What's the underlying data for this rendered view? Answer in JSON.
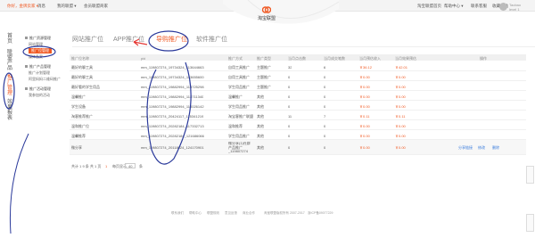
{
  "topbar": {
    "greeting": "你好，金牌卖家 ▾",
    "msg": "消息",
    "myalimama": "我的联盟 ▾",
    "member": "会员联盟商家",
    "tb_home": "淘宝联盟首页",
    "help": "帮助中心 ▾",
    "service": "联系客服",
    "favorite": "收藏本站"
  },
  "brand": {
    "name": "淘宝联盟"
  },
  "user": {
    "line1": "Taobao",
    "line2": "level 1"
  },
  "left_nav": [
    {
      "label": "首页"
    },
    {
      "label": "联盟产品"
    },
    {
      "label": "推广管理"
    },
    {
      "label": "效果报表"
    }
  ],
  "submenu": {
    "sec1": "推广资源管理",
    "item1": "网站管理",
    "item1_active": "推广位管理",
    "item2": "媒体备案",
    "sec2": "推广产品管理",
    "item3": "推广计划管理",
    "item4": "阿里妈妈二维码推广",
    "sec3": "推广活动管理",
    "item5": "我参加的活动"
  },
  "tabs": [
    {
      "label": "网站推广位"
    },
    {
      "label": "APP推广位"
    },
    {
      "label": "导购推广位"
    },
    {
      "label": "软件推广位"
    }
  ],
  "table": {
    "headers": [
      "推广位名称",
      "pid",
      "推广方式",
      "推广类型",
      "当月点击数",
      "当月成交笔数",
      "当月预估收入",
      "当月效果预估",
      "操作"
    ],
    "rows": [
      {
        "name": "最好的聊工具",
        "pid": "mm_119807274_19734324_113644663",
        "way": "自用工具推广",
        "type": "主题推广",
        "clicks": "32",
        "orders": "6",
        "income": "￥36.12",
        "est": "￥42.01"
      },
      {
        "name": "最好的聊工具",
        "pid": "mm_119807274_19734324_113655600",
        "way": "自用工具推广",
        "type": "主题推广",
        "clicks": "0",
        "orders": "0",
        "income": "￥0.00",
        "est": "￥0.00"
      },
      {
        "name": "最好看的学生用品",
        "pid": "mm_119807274_19882994_113725298",
        "way": "学生用品推广",
        "type": "主题推广",
        "clicks": "0",
        "orders": "0",
        "income": "￥0.00",
        "est": "￥0.00"
      },
      {
        "name": "温馨推广",
        "pid": "mm_119807274_19882994_113711340",
        "way": "温馨推广",
        "type": "其他",
        "clicks": "0",
        "orders": "0",
        "income": "￥0.00",
        "est": "￥0.00"
      },
      {
        "name": "学生设备",
        "pid": "mm_119807274_19882994_114026142",
        "way": "学生用品推广",
        "type": "其他",
        "clicks": "0",
        "orders": "0",
        "income": "￥0.00",
        "est": "￥0.00"
      },
      {
        "name": "淘客推荐推广",
        "pid": "mm_119807274_20424117_115341219",
        "way": "淘宝客推广联盟",
        "type": "其他",
        "clicks": "11",
        "orders": "7",
        "income": "￥0.11",
        "est": "￥0.11"
      },
      {
        "name": "温和推广位",
        "pid": "mm_119807274_20282184_117332713",
        "way": "温和推荐",
        "type": "其他",
        "clicks": "0",
        "orders": "0",
        "income": "￥0.00",
        "est": "￥0.00"
      },
      {
        "name": "温馨推荐",
        "pid": "mm_119807274_20282184_121686066",
        "way": "学生用品推广",
        "type": "其他",
        "clicks": "0",
        "orders": "0",
        "income": "￥0.00",
        "est": "￥0.00"
      },
      {
        "name": "微分享",
        "pid": "mm_119807274_20118624_124170901",
        "way": "微分享(1)社群产品推广_119807274",
        "type": "其他",
        "clicks": "0",
        "orders": "0",
        "income": "￥0.00",
        "est": "￥0.00",
        "actions": [
          "分享链接",
          "修改",
          "删除"
        ]
      }
    ]
  },
  "pager": {
    "summary": "共计 1 9 条 共 1 页",
    "page": "1",
    "per_page_label": "每页显示",
    "per_page": "40",
    "unit": "条"
  },
  "footer": {
    "links": [
      "联系我们",
      "帮助中心",
      "联盟规则",
      "意见反馈",
      "商业合作"
    ],
    "copyright": "淘宝联盟版权所有 2007-2017",
    "icp": "浙ICP备09077229"
  },
  "colors": {
    "accent": "#f05a24",
    "annotation": "#2b3a9b",
    "link": "#3b7ddd"
  }
}
